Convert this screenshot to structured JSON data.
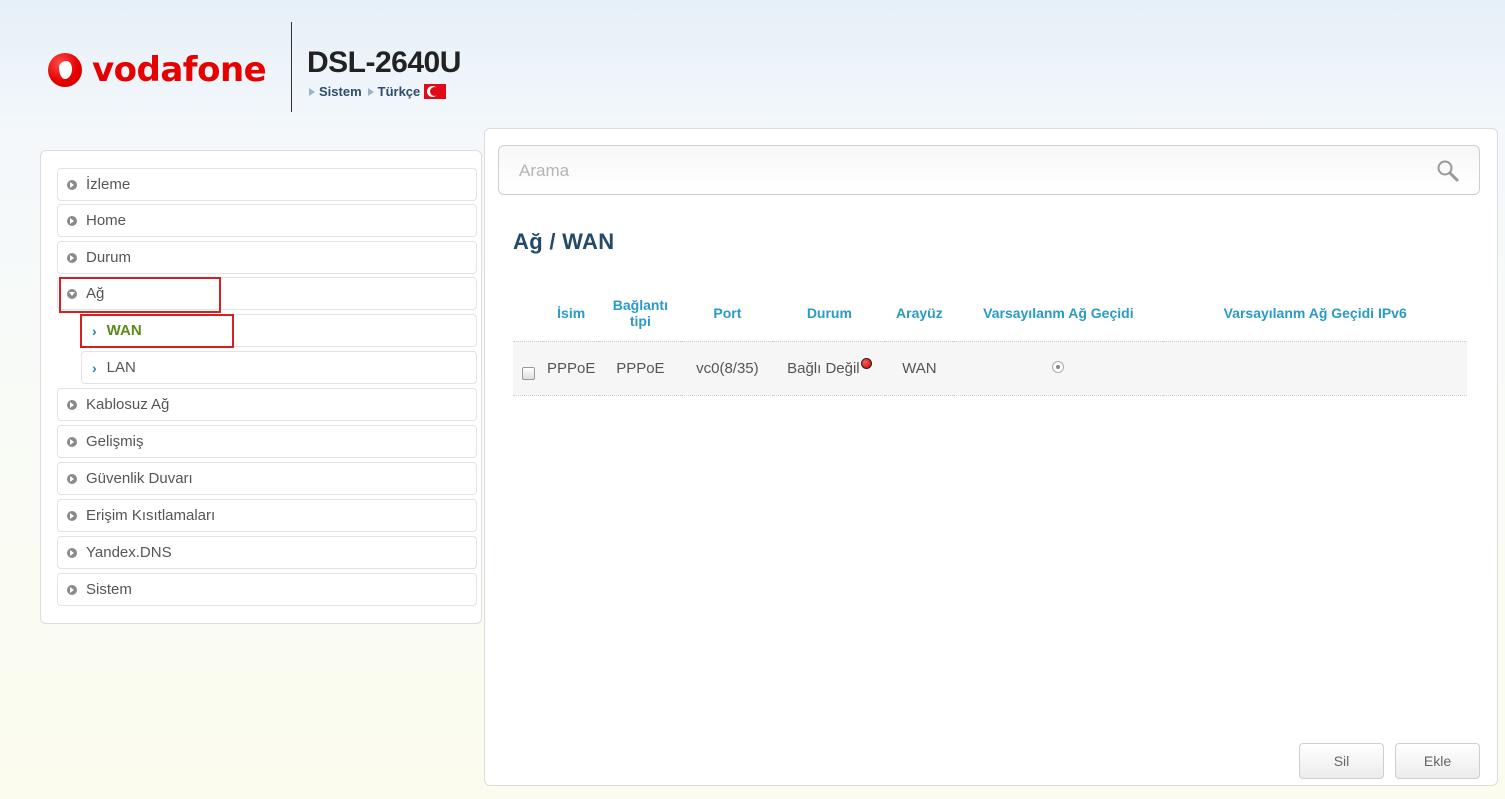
{
  "header": {
    "brand": "vodafone",
    "model": "DSL-2640U",
    "nav": [
      "Sistem",
      "Türkçe"
    ]
  },
  "sidebar": {
    "items": [
      {
        "label": "İzleme"
      },
      {
        "label": "Home"
      },
      {
        "label": "Durum"
      },
      {
        "label": "Ağ",
        "expanded": true
      },
      {
        "label": "WAN",
        "sub": true,
        "active": true
      },
      {
        "label": "LAN",
        "sub": true
      },
      {
        "label": "Kablosuz Ağ"
      },
      {
        "label": "Gelişmiş"
      },
      {
        "label": "Güvenlik Duvarı"
      },
      {
        "label": "Erişim Kısıtlamaları"
      },
      {
        "label": "Yandex.DNS"
      },
      {
        "label": "Sistem"
      }
    ]
  },
  "search": {
    "placeholder": "Arama",
    "value": ""
  },
  "page": {
    "title": "Ağ /  WAN"
  },
  "table": {
    "columns": [
      "İsim",
      "Bağlantı tipi",
      "Port",
      "Durum",
      "Arayüz",
      "Varsayılanm Ağ Geçidi",
      "Varsayılanm Ağ Geçidi IPv6"
    ],
    "rows": [
      {
        "name": "PPPoE",
        "type": "PPPoE",
        "port": "vc0(8/35)",
        "status": "Bağlı Değil",
        "iface": "WAN",
        "default_gw": true,
        "default_gw6": ""
      }
    ]
  },
  "buttons": {
    "delete": "Sil",
    "add": "Ekle"
  },
  "colors": {
    "brand": "#e60000",
    "heading": "#234a66",
    "column_header": "#2a9ac6",
    "active_item": "#5a8a1a",
    "highlight_box": "#d42020"
  },
  "icons": [
    "vodafone-logo-icon",
    "arrow-right-icon",
    "turkish-flag-icon",
    "chevron-right-icon",
    "search-icon",
    "status-disconnected-icon"
  ]
}
